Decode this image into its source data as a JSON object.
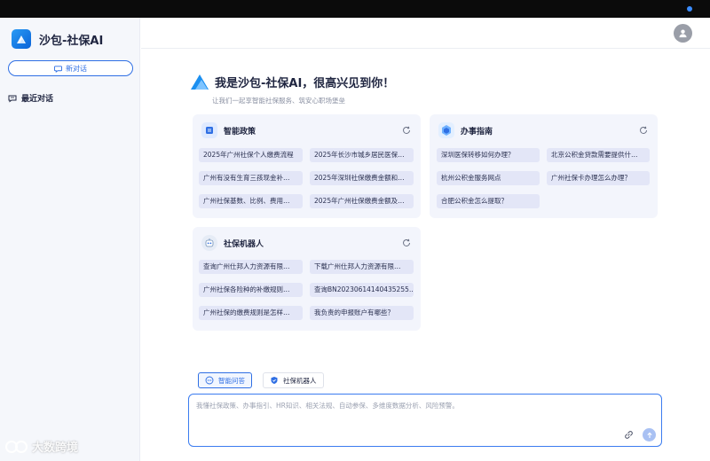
{
  "sidebar": {
    "brand_name": "沙包-社保AI",
    "new_chat_label": "新对话",
    "recent_label": "最近对话"
  },
  "main": {
    "greeting_title": "我是沙包-社保AI，很高兴见到你！",
    "greeting_subtitle": "让我们一起享智能社保服务、筑安心职场堡垒"
  },
  "cards": {
    "policy": {
      "title": "智能政策",
      "icon": "policy-book-icon",
      "chips": [
        "2025年广州社保个人缴费流程",
        "2025年长沙市城乡居民医保…",
        "广州有没有生育三孩现金补…",
        "2025年深圳社保缴费金额和…",
        "广州社保基数、比例、费用…",
        "2025年广州社保缴费金额及…"
      ]
    },
    "guide": {
      "title": "办事指南",
      "icon": "guide-icon",
      "chips": [
        "深圳医保转移如何办理？",
        "北京公积金贷款需要提供什…",
        "杭州公积金服务网点",
        "广州社保卡办理怎么办理？",
        "合肥公积金怎么提取？"
      ]
    },
    "robot": {
      "title": "社保机器人",
      "icon": "robot-icon",
      "chips": [
        "查询广州仕邦人力资源有限…",
        "下载广州仕邦人力资源有限…",
        "广州社保各险种的补缴规则…",
        "查询BN20230614140435255…",
        "广州社保的缴费规则是怎样…",
        "我负责的申报账户有哪些？"
      ]
    }
  },
  "modes": {
    "qa_label": "智能问答",
    "robot_label": "社保机器人"
  },
  "input": {
    "placeholder": "我懂社保政策、办事指引、HR知识、相关法规、自动参保、多维度数据分析、风险预警。"
  },
  "watermark": "大数跨境",
  "colors": {
    "accent": "#2f6fe4",
    "card_bg": "#f3f5fc",
    "chip_bg": "#e3e6f7"
  }
}
